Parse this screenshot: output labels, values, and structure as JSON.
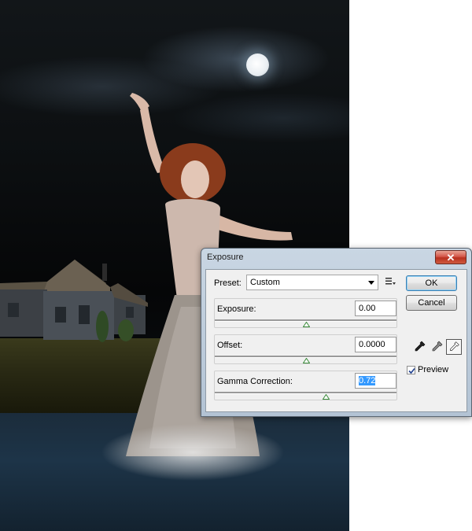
{
  "dialog": {
    "title": "Exposure",
    "close_icon": "close-icon",
    "preset": {
      "label": "Preset:",
      "value": "Custom",
      "menu_icon": "preset-options-icon"
    },
    "sliders": [
      {
        "label": "Exposure:",
        "value": "0.00",
        "position": 0.5,
        "active": false
      },
      {
        "label": "Offset:",
        "value": "0.0000",
        "position": 0.5,
        "active": false
      },
      {
        "label": "Gamma Correction:",
        "value": "0.72",
        "position": 0.61,
        "active": true
      }
    ],
    "buttons": {
      "ok": "OK",
      "cancel": "Cancel"
    },
    "eyedroppers": [
      "black-point-eyedropper-icon",
      "gray-point-eyedropper-icon",
      "white-point-eyedropper-icon"
    ],
    "preview": {
      "label": "Preview",
      "checked": true
    }
  },
  "colors": {
    "title_gradient_top": "#c9d6e3",
    "close_button": "#c8432f",
    "selection": "#3399ff",
    "slider_thumb": "#3a8a3a"
  }
}
